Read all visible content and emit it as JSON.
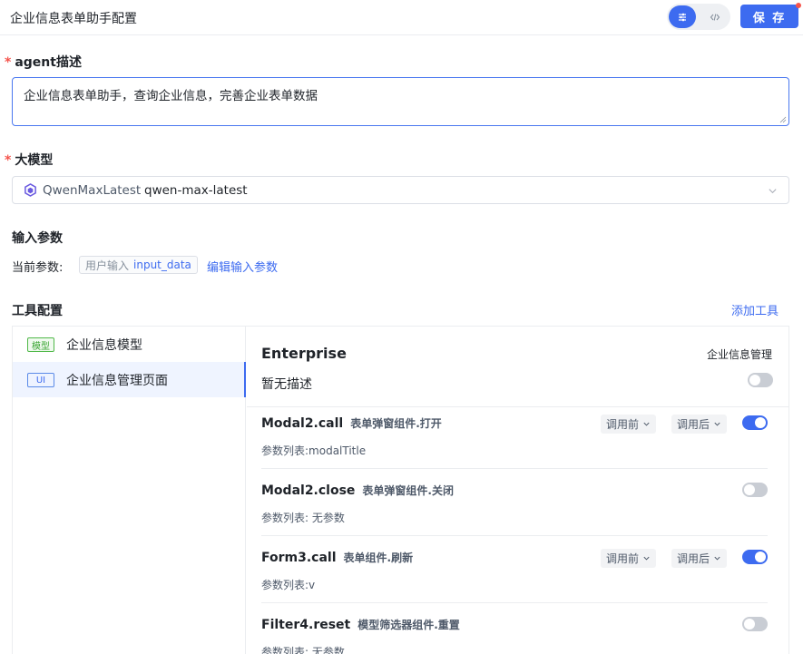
{
  "header": {
    "title": "企业信息表单助手配置",
    "save_label": "保 存"
  },
  "agent_desc": {
    "label": "agent描述",
    "value": "企业信息表单助手，查询企业信息，完善企业表单数据"
  },
  "model": {
    "label": "大模型",
    "provider": "QwenMaxLatest",
    "model_id": "qwen-max-latest"
  },
  "input_params": {
    "label": "输入参数",
    "current_label": "当前参数:",
    "chip_label": "用户输入",
    "chip_value": "input_data",
    "edit_link": "编辑输入参数"
  },
  "tools": {
    "label": "工具配置",
    "add_link": "添加工具",
    "list": [
      {
        "tag": "模型",
        "name": "企业信息模型"
      },
      {
        "tag": "UI",
        "name": "企业信息管理页面"
      }
    ],
    "detail": {
      "title": "Enterprise",
      "subtitle": "企业信息管理",
      "description": "暂无描述",
      "enabled": false
    },
    "actions": [
      {
        "name": "Modal2.call",
        "desc": "表单弹窗组件.打开",
        "params": "参数列表:modalTitle",
        "before": "调用前",
        "after": "调用后",
        "enabled": true
      },
      {
        "name": "Modal2.close",
        "desc": "表单弹窗组件.关闭",
        "params": "参数列表: 无参数",
        "enabled": false
      },
      {
        "name": "Form3.call",
        "desc": "表单组件.刷新",
        "params": "参数列表:v",
        "before": "调用前",
        "after": "调用后",
        "enabled": true
      },
      {
        "name": "Filter4.reset",
        "desc": "模型筛选器组件.重置",
        "params": "参数列表: 无参数",
        "enabled": false
      }
    ]
  },
  "colors": {
    "primary": "#3d6bf0",
    "required": "#f5544c",
    "switch_off": "#c9cdd4"
  }
}
